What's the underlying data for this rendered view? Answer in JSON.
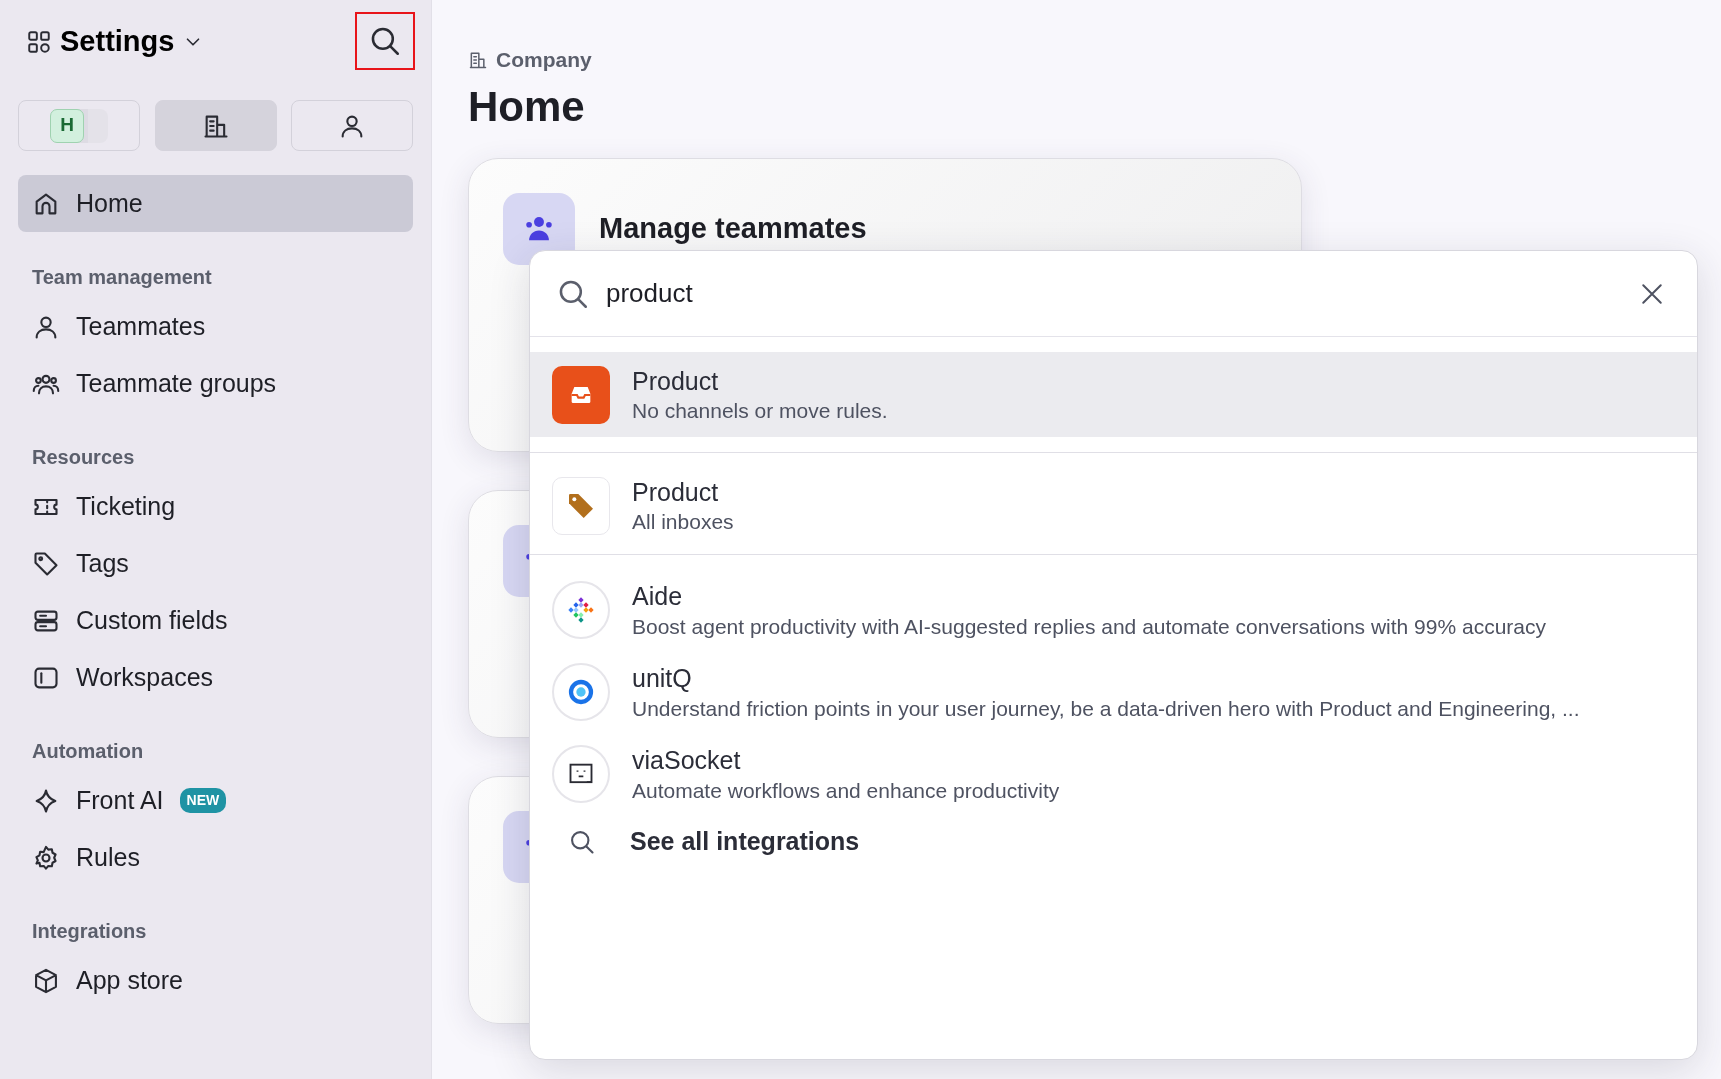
{
  "sidebar": {
    "title": "Settings",
    "search_highlighted": true,
    "scope_buttons": [
      {
        "kind": "avatar",
        "label": "H",
        "selected": false
      },
      {
        "kind": "company",
        "selected": true
      },
      {
        "kind": "person",
        "selected": false
      }
    ],
    "home": {
      "label": "Home",
      "selected": true
    },
    "sections": [
      {
        "heading": "Team management",
        "items": [
          {
            "kind": "person",
            "label": "Teammates"
          },
          {
            "kind": "group",
            "label": "Teammate groups"
          }
        ]
      },
      {
        "heading": "Resources",
        "items": [
          {
            "kind": "ticket",
            "label": "Ticketing"
          },
          {
            "kind": "tag",
            "label": "Tags"
          },
          {
            "kind": "fields",
            "label": "Custom fields"
          },
          {
            "kind": "workspace",
            "label": "Workspaces"
          }
        ]
      },
      {
        "heading": "Automation",
        "items": [
          {
            "kind": "sparkle",
            "label": "Front AI",
            "badge": "NEW"
          },
          {
            "kind": "gear",
            "label": "Rules"
          }
        ]
      },
      {
        "heading": "Integrations",
        "items": [
          {
            "kind": "cube",
            "label": "App store"
          }
        ]
      }
    ]
  },
  "main": {
    "breadcrumb": "Company",
    "title": "Home",
    "cards": [
      {
        "kind": "titled",
        "title": "Manage teammates"
      },
      {
        "kind": "covered"
      },
      {
        "kind": "covered"
      }
    ]
  },
  "search_dialog": {
    "query": "product",
    "results": [
      {
        "kind": "inbox",
        "title": "Product",
        "subtitle": "No channels or move rules.",
        "selected": true
      },
      {
        "kind": "tag",
        "title": "Product",
        "subtitle": "All inboxes",
        "selected": false
      }
    ],
    "integrations": [
      {
        "kind": "dots",
        "title": "Aide",
        "subtitle": "Boost agent productivity with AI-suggested replies and automate conversations with 99% accuracy"
      },
      {
        "kind": "ring",
        "title": "unitQ",
        "subtitle": "Understand friction points in your user journey, be a data-driven hero with Product and Engineering, ..."
      },
      {
        "kind": "face",
        "title": "viaSocket",
        "subtitle": "Automate workflows and enhance productivity"
      }
    ],
    "see_all": "See all integrations"
  }
}
